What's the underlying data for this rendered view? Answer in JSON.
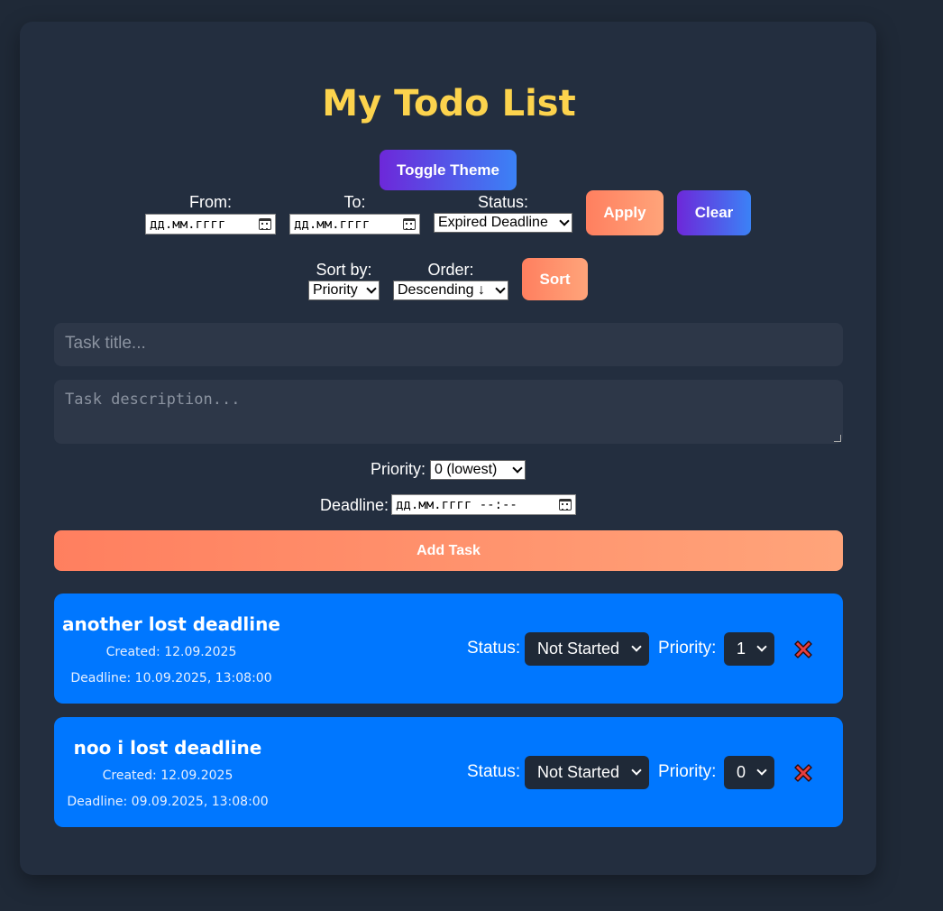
{
  "app": {
    "title": "My Todo List",
    "toggle_theme_label": "Toggle Theme"
  },
  "filter": {
    "from_label": "From:",
    "from_value": "дд.мм.гггг",
    "to_label": "To:",
    "to_value": "дд.мм.гггг",
    "status_label": "Status:",
    "status_value": "Expired Deadline",
    "apply_label": "Apply",
    "clear_label": "Clear"
  },
  "sort": {
    "sort_by_label": "Sort by:",
    "sort_by_value": "Priority",
    "order_label": "Order:",
    "order_value": "Descending ↓",
    "sort_label": "Sort"
  },
  "form": {
    "title_placeholder": "Task title...",
    "description_placeholder": "Task description...",
    "priority_label": "Priority:",
    "priority_value": "0 (lowest)",
    "deadline_label": "Deadline:",
    "deadline_value": "дд.мм.гггг --:--",
    "add_label": "Add Task"
  },
  "tasks": [
    {
      "title": "another lost deadline",
      "created": "Created: 12.09.2025",
      "deadline": "Deadline: 10.09.2025, 13:08:00",
      "status_label": "Status:",
      "status_value": "Not Started",
      "priority_label": "Priority:",
      "priority_value": "1"
    },
    {
      "title": "noo i lost deadline",
      "created": "Created: 12.09.2025",
      "deadline": "Deadline: 09.09.2025, 13:08:00",
      "status_label": "Status:",
      "status_value": "Not Started",
      "priority_label": "Priority:",
      "priority_value": "0"
    }
  ],
  "colors": {
    "background": "#1f2937",
    "card": "#232e3f",
    "title": "#fcd34d",
    "task_card": "#0077ff",
    "delete_icon": "#e53e3e"
  },
  "icons": {
    "calendar": "calendar-icon",
    "delete": "cross-mark-icon"
  }
}
